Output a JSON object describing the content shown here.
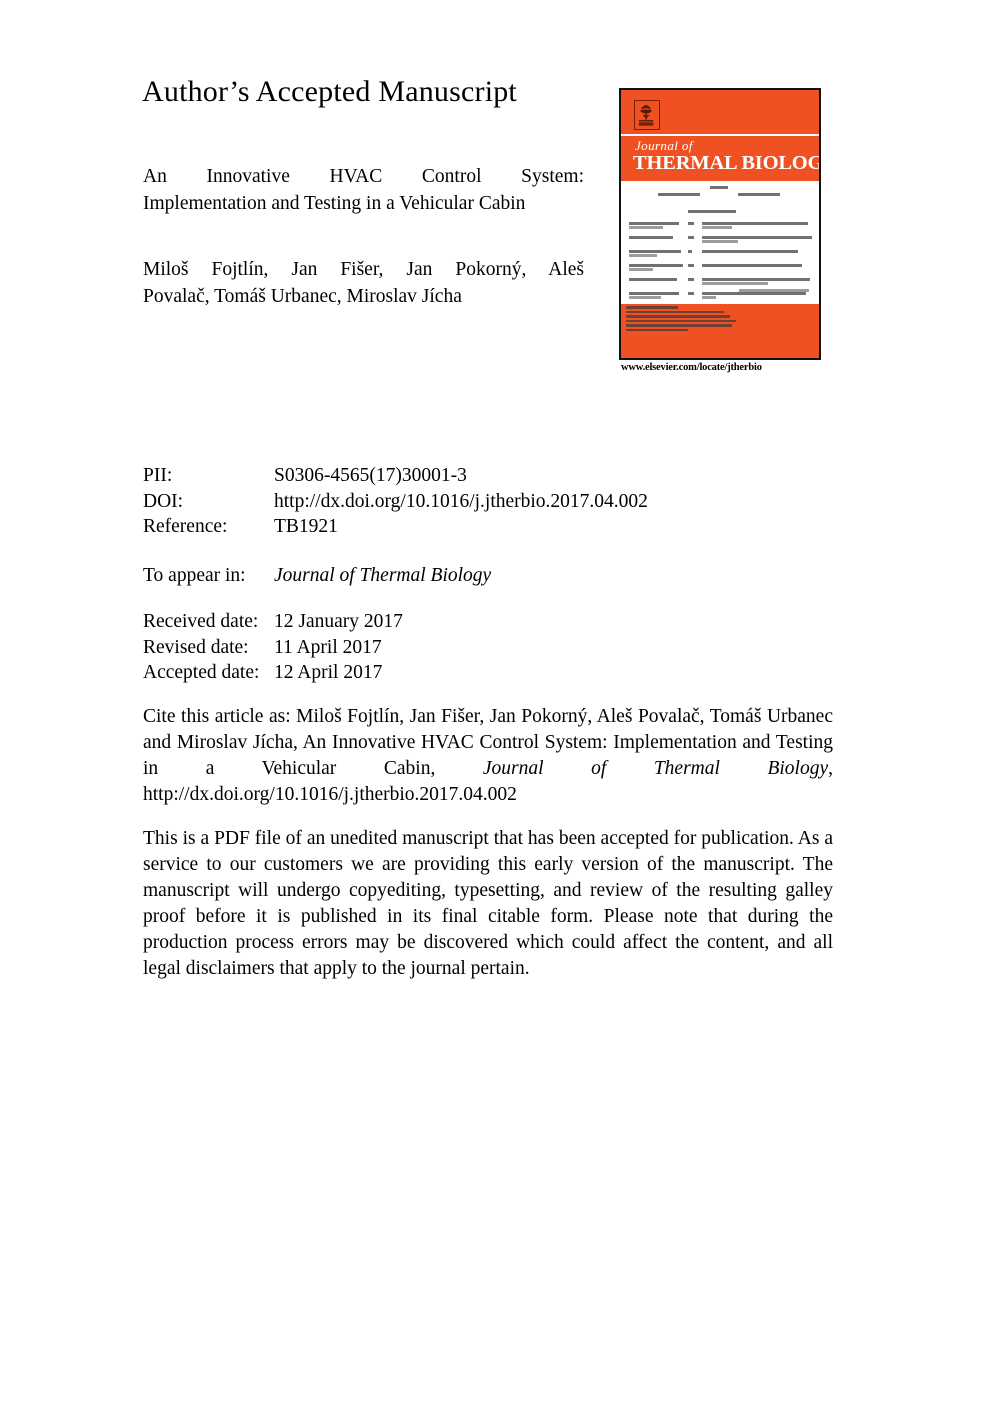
{
  "heading": "Author’s Accepted Manuscript",
  "article": {
    "title_line1": "An Innovative HVAC Control System:",
    "title_line2": "Implementation and Testing in a Vehicular Cabin",
    "authors_line1": "Miloš Fojtlín, Jan Fišer, Jan Pokorný, Aleš",
    "authors_line2": "Povalač, Tomáš Urbanec, Miroslav Jícha"
  },
  "cover": {
    "publisher_logo": "elsevier-tree-logo",
    "journal_of": "Journal of",
    "journal_name": "THERMAL BIOLOGY",
    "url": "www.elsevier.com/locate/jtherbio",
    "accent_color": "#EF5122",
    "border_color": "#111111"
  },
  "metadata": {
    "rows": [
      {
        "label": "PII:",
        "value": "S0306-4565(17)30001-3"
      },
      {
        "label": "DOI:",
        "value": "http://dx.doi.org/10.1016/j.jtherbio.2017.04.002"
      },
      {
        "label": "Reference:",
        "value": "TB1921"
      }
    ]
  },
  "appear_in": {
    "label": "To appear in:",
    "value": "Journal of Thermal Biology"
  },
  "dates": {
    "rows": [
      {
        "label": "Received date:",
        "value": "12 January 2017"
      },
      {
        "label": "Revised date:",
        "value": "11 April 2017"
      },
      {
        "label": "Accepted date:",
        "value": "12 April 2017"
      }
    ]
  },
  "citation": {
    "prefix": "Cite this article as: Miloš Fojtlín, Jan Fišer, Jan Pokorný, Aleš Povalač, Tomáš Urbanec and Miroslav Jícha, An Innovative HVAC Control System: Implementation and Testing in a Vehicular Cabin, ",
    "journal": "Journal of Thermal Biology",
    "suffix": ", http://dx.doi.org/10.1016/j.jtherbio.2017.04.002"
  },
  "disclaimer": {
    "text": "This is a PDF file of an unedited manuscript that has been accepted for publication. As a service to our customers we are providing this early version of the manuscript. The manuscript will undergo copyediting, typesetting, and review of the resulting galley proof before it is published in its final citable form. Please note that during the production process errors may be discovered which could affect the content, and all legal disclaimers that apply to the journal pertain."
  }
}
